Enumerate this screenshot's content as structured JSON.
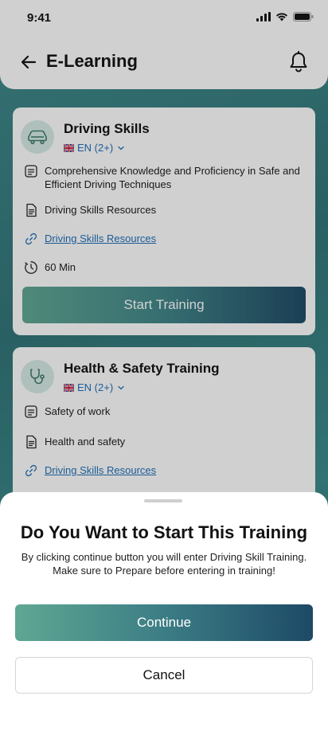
{
  "status_bar": {
    "time": "9:41"
  },
  "header": {
    "title": "E-Learning"
  },
  "trainings": [
    {
      "title": "Driving Skills",
      "language": "EN (2+)",
      "description": "Comprehensive Knowledge and Proficiency in Safe and Efficient Driving Techniques",
      "resources_text": "Driving Skills Resources",
      "resources_link": "Driving Skills Resources",
      "duration": "60 Min",
      "start_label": "Start Training"
    },
    {
      "title": "Health & Safety Training",
      "language": "EN (2+)",
      "description": "Safety of work",
      "resources_text": "Health and safety",
      "resources_link": "Driving Skills Resources"
    }
  ],
  "sheet": {
    "title": "Do You Want to Start This Training",
    "description": "By clicking continue button you will enter Driving Skill Training. Make sure to Prepare before entering in training!",
    "continue_label": "Continue",
    "cancel_label": "Cancel"
  },
  "colors": {
    "accent_link": "#1e6fb8",
    "button_gradient_start": "#5fa793",
    "button_gradient_end": "#1d4a66",
    "icon_circle": "#d6ebe6"
  },
  "icons": {
    "back": "arrow-left-icon",
    "bell": "bell-icon",
    "car": "car-icon",
    "stethoscope": "stethoscope-icon",
    "description": "note-icon",
    "document": "document-icon",
    "link": "link-icon",
    "duration": "timer-icon"
  }
}
